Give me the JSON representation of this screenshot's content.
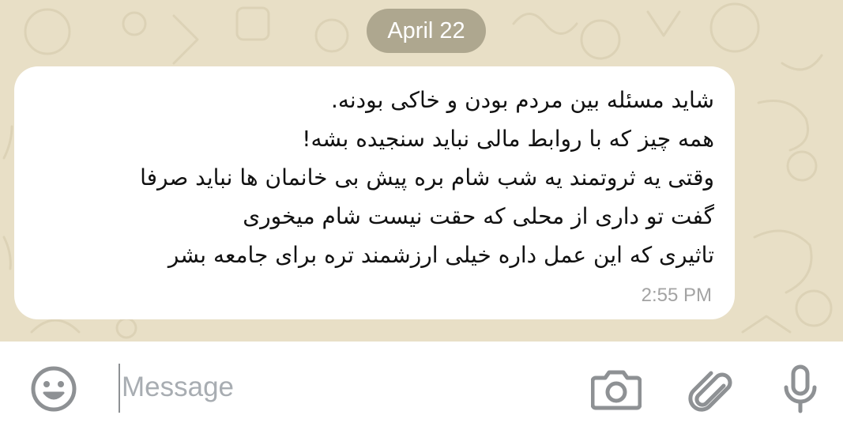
{
  "chat": {
    "date_label": "April 22",
    "message": {
      "lines": [
        "شاید مسئله بین مردم بودن و خاکی بودنه.",
        "همه چیز که با روابط مالی نباید سنجیده بشه!",
        "وقتی یه ثروتمند یه شب شام بره پیش بی خانمان ها نباید صرفا",
        "گفت تو داری از محلی که حقت نیست شام میخوری",
        "تاثیری که این عمل داره خیلی ارزشمند تره برای جامعه بشر"
      ],
      "time": "2:55 PM"
    }
  },
  "input_bar": {
    "placeholder": "Message",
    "value": "",
    "icons": {
      "emoji": "emoji-icon",
      "camera": "camera-icon",
      "attach": "paperclip-icon",
      "mic": "microphone-icon"
    }
  },
  "colors": {
    "chat_background": "#e8dfc6",
    "date_pill": "#aea78f",
    "bubble": "#ffffff",
    "timestamp": "#a3a3a3",
    "icon_gray": "#8e9194",
    "placeholder": "#a8adb2"
  }
}
